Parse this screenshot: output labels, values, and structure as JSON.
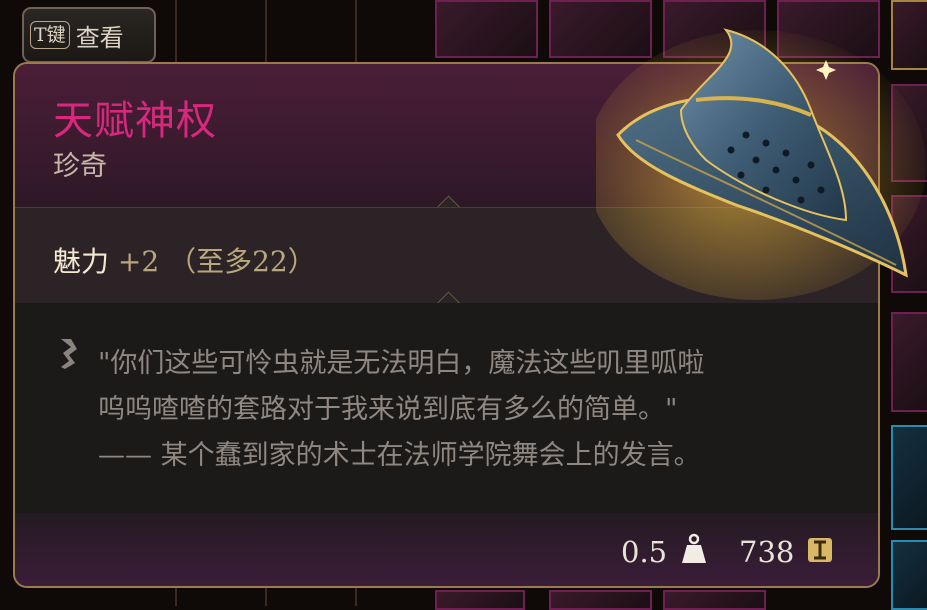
{
  "key_hint": {
    "key": "T键",
    "label": "查看"
  },
  "item": {
    "name": "天赋神权",
    "rarity": "珍奇",
    "stat_label": "魅力",
    "stat_value": "+2 （至多22）",
    "lore_lines": [
      "\"你们这些可怜虫就是无法明白，魔法这些叽里呱啦",
      "呜呜喳喳的套路对于我来说到底有多么的简单。\"",
      "—— 某个蠢到家的术士在法师学院舞会上的发言。"
    ],
    "weight": "0.5",
    "price": "738"
  },
  "colors": {
    "name": "#d9277d",
    "frame": "#9b7a4b",
    "lore_text": "#8f8882"
  },
  "icons": {
    "lore": "feather-icon",
    "weight": "weight-icon",
    "price": "gold-coin-icon",
    "item": "wizard-hat-icon"
  }
}
